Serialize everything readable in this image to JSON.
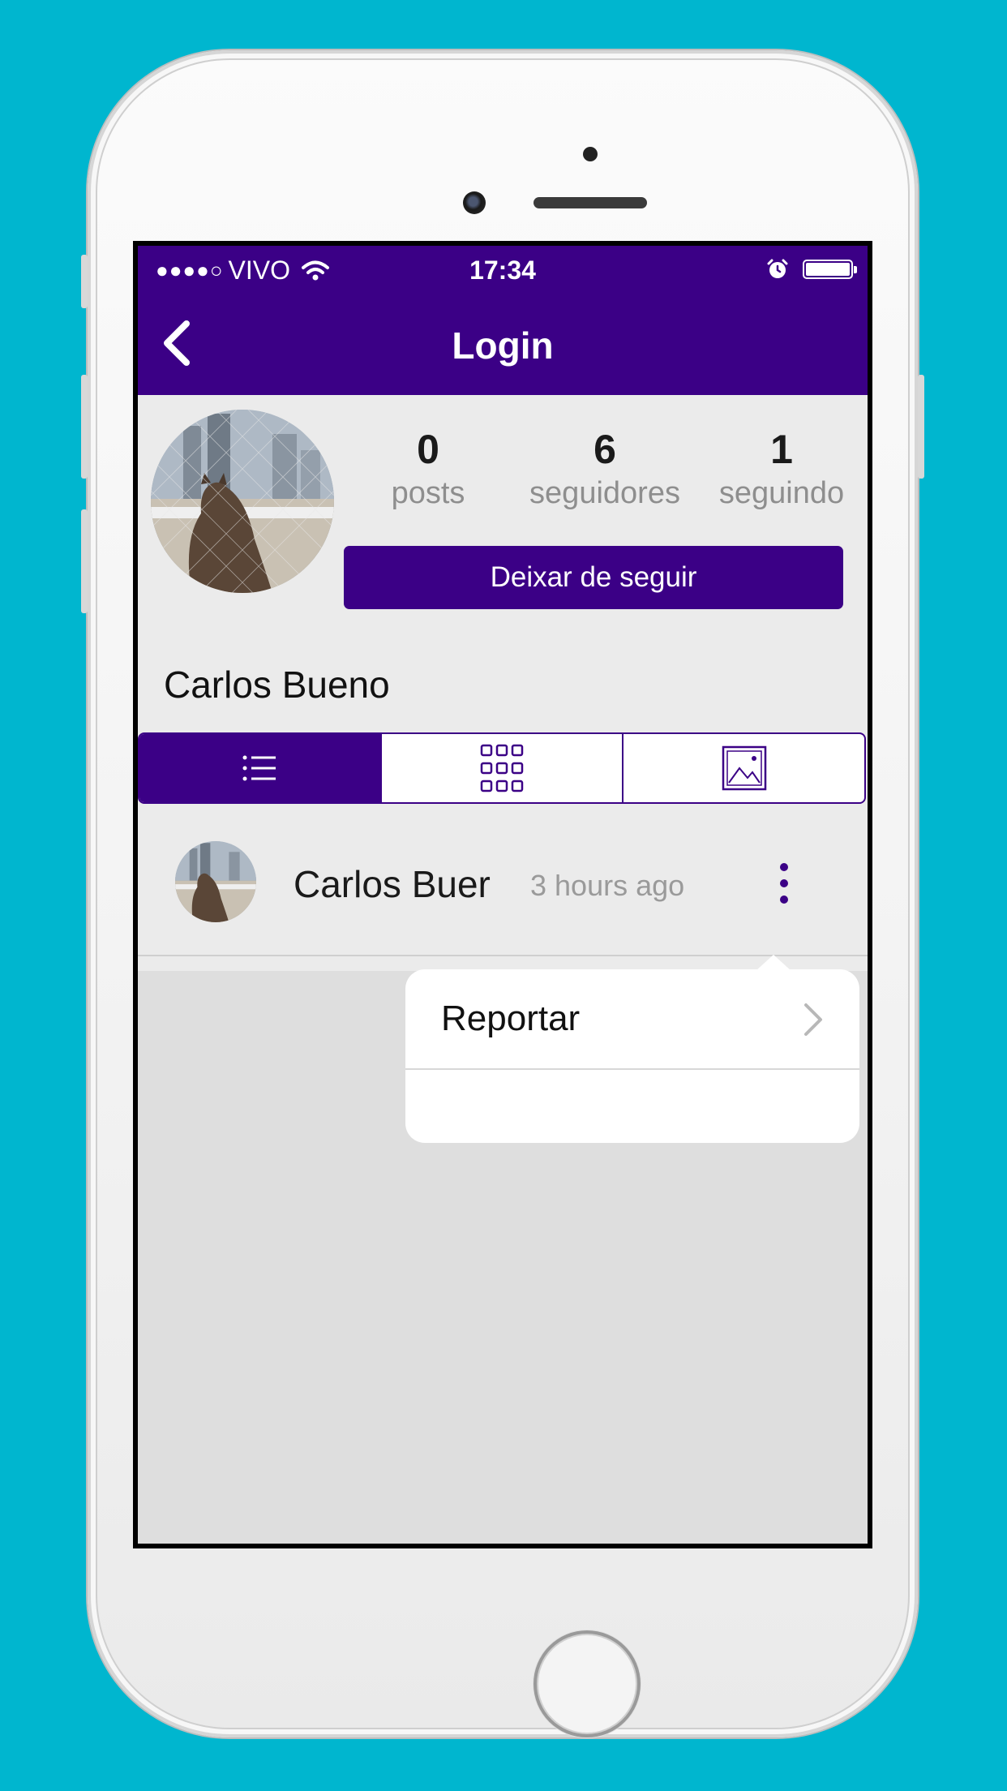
{
  "status_bar": {
    "signal": "●●●●○",
    "carrier": "VIVO",
    "time": "17:34"
  },
  "navbar": {
    "title": "Login"
  },
  "profile": {
    "stats": [
      {
        "value": "0",
        "label": "posts"
      },
      {
        "value": "6",
        "label": "seguidores"
      },
      {
        "value": "1",
        "label": "seguindo"
      }
    ],
    "follow_button": "Deixar de seguir",
    "name": "Carlos Bueno"
  },
  "view_tabs": {
    "items": [
      "list-icon",
      "grid-icon",
      "image-icon"
    ],
    "active": 0
  },
  "post": {
    "author": "Carlos Buer",
    "time": "3 hours ago"
  },
  "popover": {
    "items": [
      {
        "label": "Reportar"
      }
    ]
  },
  "colors": {
    "accent": "#3b0086",
    "background": "#00b6cf"
  }
}
